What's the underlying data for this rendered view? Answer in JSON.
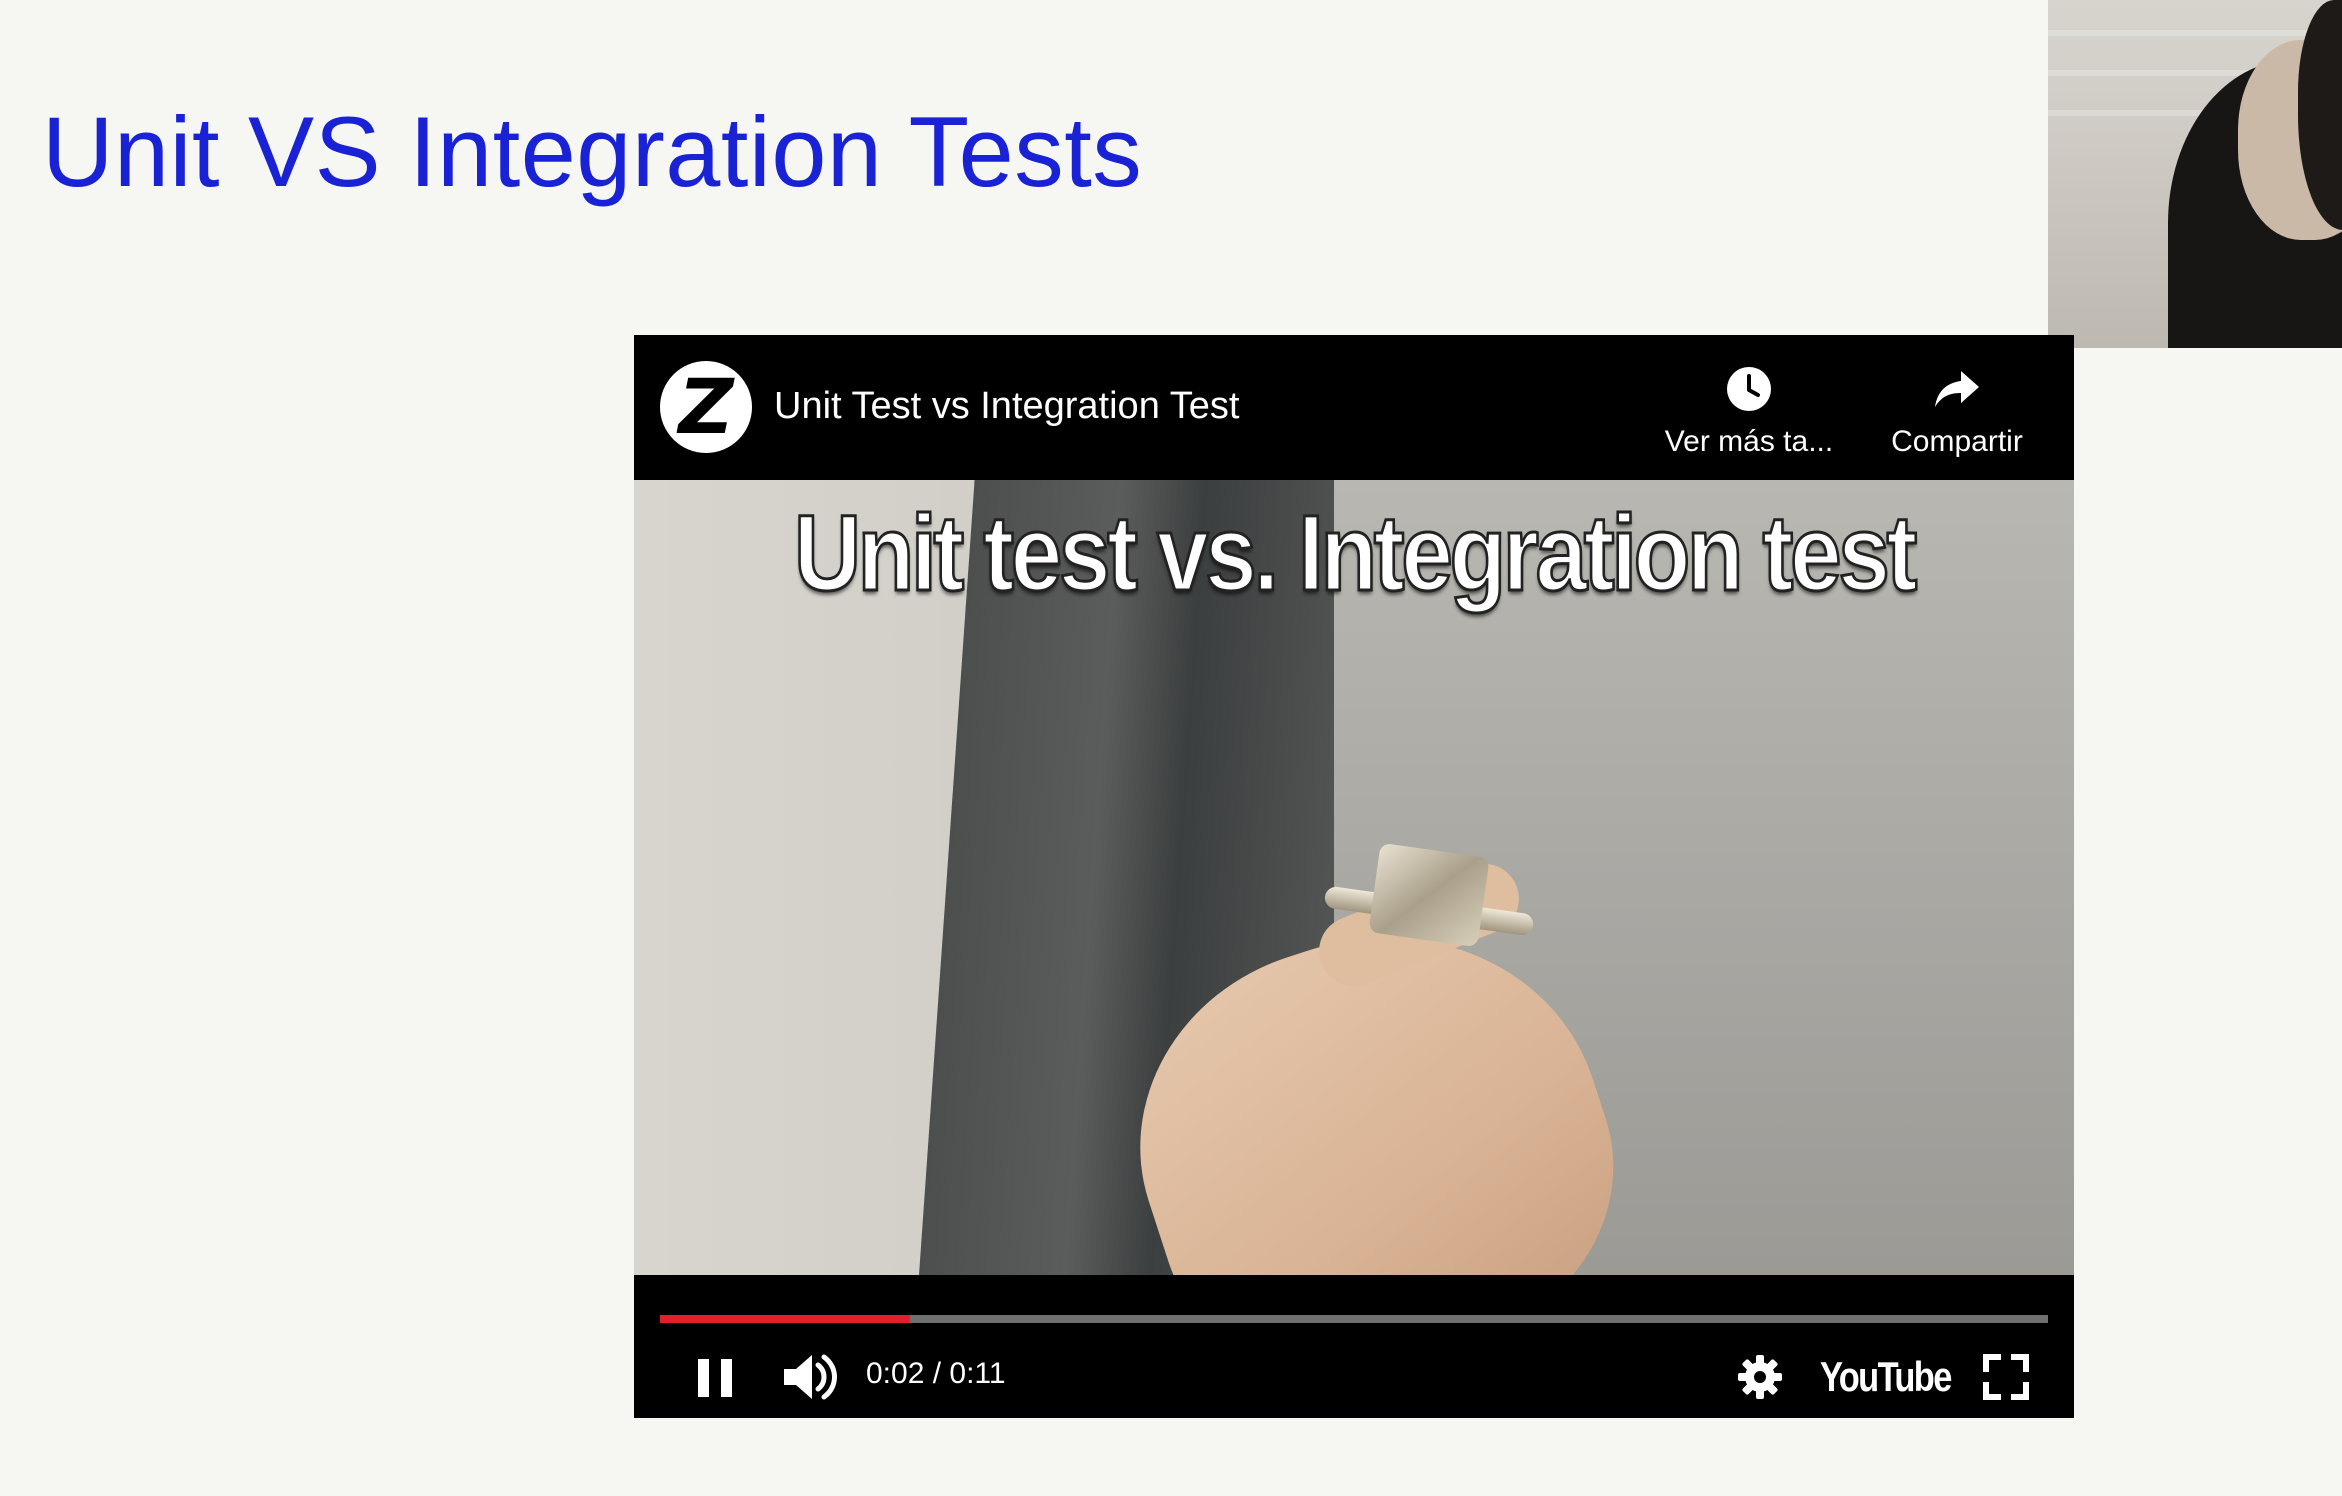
{
  "slide": {
    "title": "Unit VS Integration Tests"
  },
  "video": {
    "title": "Unit Test vs Integration Test",
    "channel_logo_letter": "Z",
    "frame_caption": "Unit test vs. Integration test",
    "actions": {
      "watch_later_label": "Ver más ta...",
      "share_label": "Compartir"
    },
    "controls": {
      "time": "0:02 / 0:11",
      "progress": 0.18,
      "brand": "YouTube"
    }
  },
  "colors": {
    "title_blue": "#1a22d6",
    "slide_bg": "#f6f6f2",
    "progress_red": "#e2202a"
  },
  "icons": {
    "watch_later": "clock-icon",
    "share": "share-arrow-icon",
    "pause": "pause-icon",
    "volume": "volume-icon",
    "settings": "gear-icon",
    "fullscreen": "fullscreen-icon"
  }
}
